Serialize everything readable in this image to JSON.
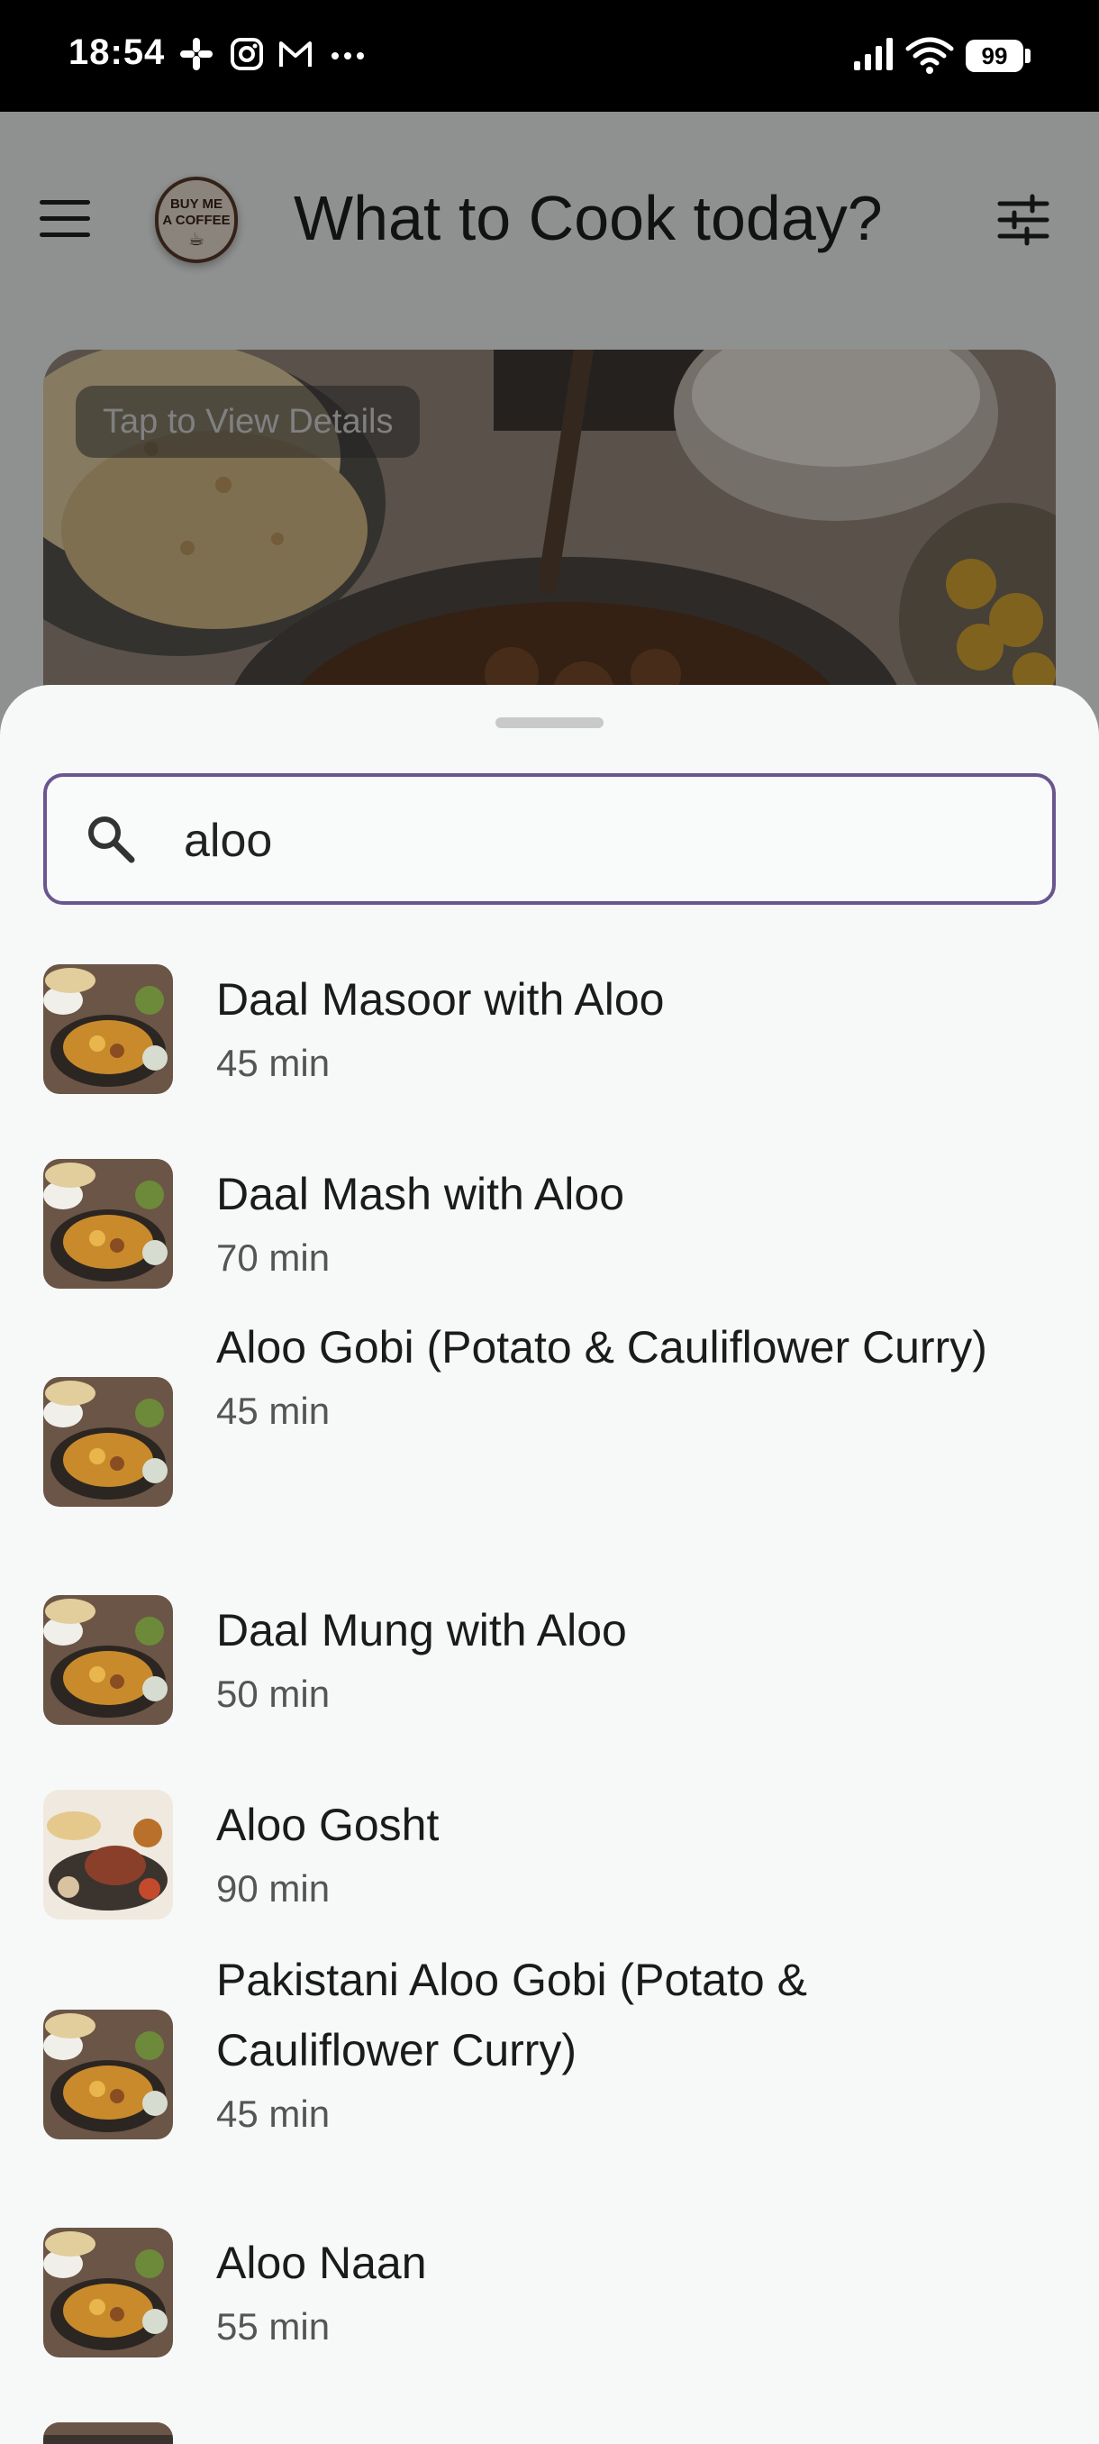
{
  "status_bar": {
    "time": "18:54",
    "battery": "99",
    "notification_icons": [
      "slack-icon",
      "instagram-icon",
      "gmail-icon",
      "more-icon"
    ],
    "system_icons": [
      "signal-icon",
      "wifi-icon",
      "battery-icon"
    ]
  },
  "app_bar": {
    "title": "What to Cook today?",
    "coffee_badge_line1": "BUY ME",
    "coffee_badge_line2": "A COFFEE"
  },
  "hero": {
    "pill_text": "Tap to View Details"
  },
  "search": {
    "value": "aloo",
    "placeholder": ""
  },
  "results": [
    {
      "title": "Daal Masoor with Aloo",
      "duration": "45 min",
      "thumb": "thali"
    },
    {
      "title": "Daal Mash with Aloo",
      "duration": "70 min",
      "thumb": "thali"
    },
    {
      "title": "Aloo Gobi (Potato & Cauliflower Curry)",
      "duration": "45 min",
      "thumb": "thali"
    },
    {
      "title": "Daal Mung with Aloo",
      "duration": "50 min",
      "thumb": "thali"
    },
    {
      "title": "Aloo Gosht",
      "duration": "90 min",
      "thumb": "meat"
    },
    {
      "title": "Pakistani Aloo Gobi (Potato & Cauliflower Curry)",
      "duration": "45 min",
      "thumb": "thali"
    },
    {
      "title": "Aloo Naan",
      "duration": "55 min",
      "thumb": "thali"
    }
  ],
  "colors": {
    "accent_border": "#6a568f",
    "sheet_bg": "#f7f9f9",
    "title_text": "#1b1b1b"
  }
}
